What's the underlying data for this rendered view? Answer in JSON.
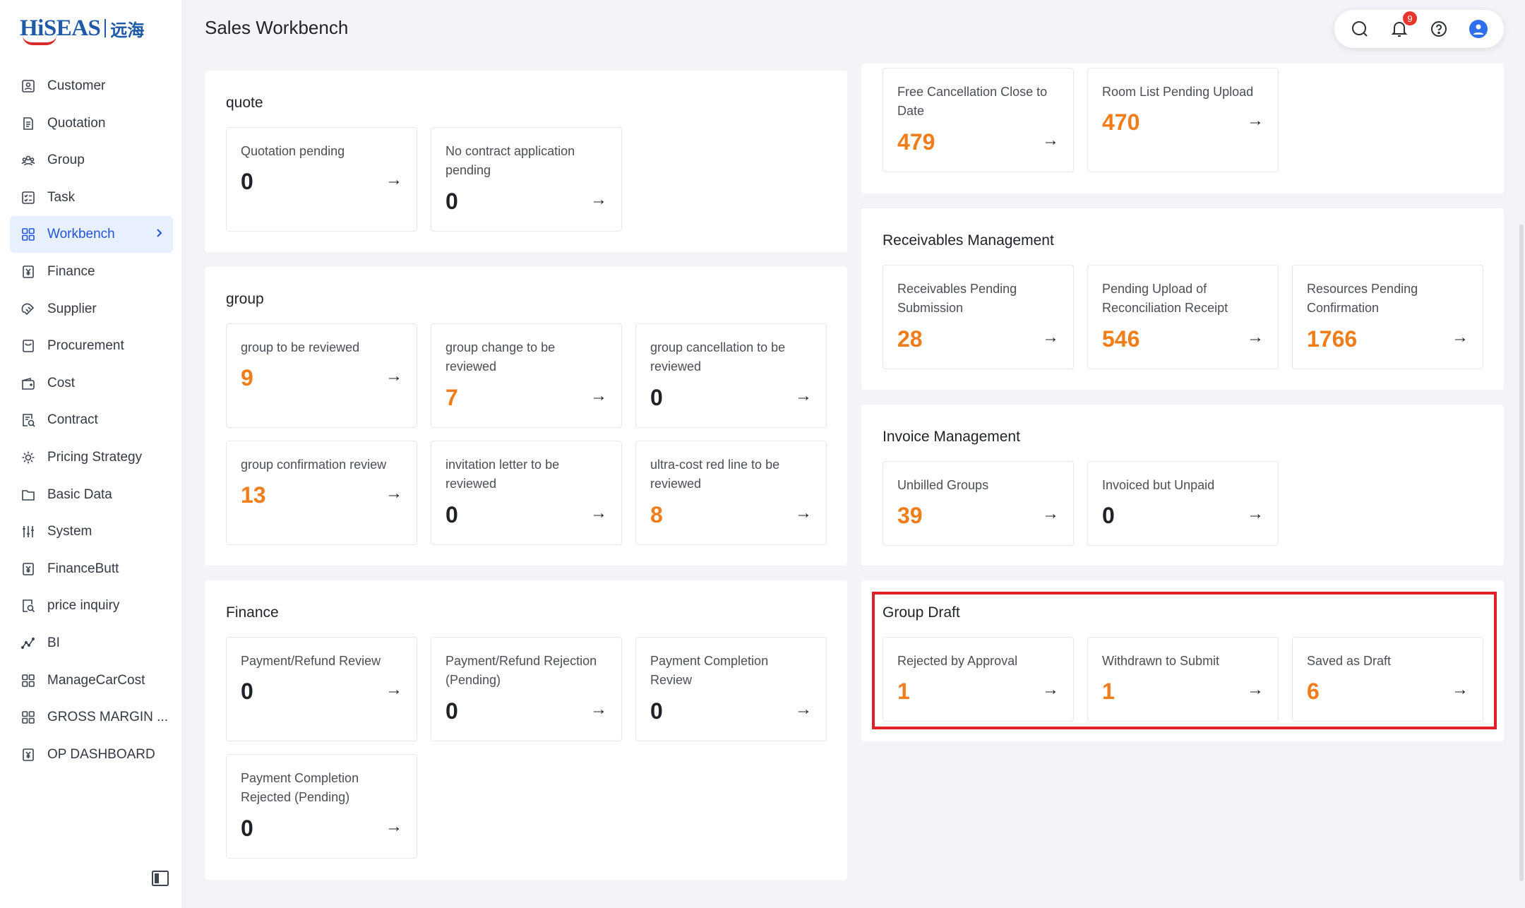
{
  "app": {
    "logo_text": "HiSEAS",
    "logo_cn": "远海",
    "page_title": "Sales Workbench"
  },
  "header": {
    "notification_count": "9",
    "icons": [
      "search-icon",
      "bell-icon",
      "help-icon",
      "user-icon"
    ]
  },
  "sidebar": {
    "items": [
      {
        "label": "Customer",
        "icon": "customer-icon"
      },
      {
        "label": "Quotation",
        "icon": "quotation-icon"
      },
      {
        "label": "Group",
        "icon": "group-icon"
      },
      {
        "label": "Task",
        "icon": "task-icon"
      },
      {
        "label": "Workbench",
        "icon": "workbench-icon",
        "active": true
      },
      {
        "label": "Finance",
        "icon": "finance-icon"
      },
      {
        "label": "Supplier",
        "icon": "supplier-icon"
      },
      {
        "label": "Procurement",
        "icon": "procurement-icon"
      },
      {
        "label": "Cost",
        "icon": "cost-icon"
      },
      {
        "label": "Contract",
        "icon": "contract-icon"
      },
      {
        "label": "Pricing  Strategy",
        "icon": "pricing-icon"
      },
      {
        "label": "Basic  Data",
        "icon": "basic-data-icon"
      },
      {
        "label": "System",
        "icon": "system-icon"
      },
      {
        "label": "FinanceButt",
        "icon": "finance-butt-icon"
      },
      {
        "label": "price  inquiry",
        "icon": "price-inquiry-icon"
      },
      {
        "label": "BI",
        "icon": "bi-icon"
      },
      {
        "label": "ManageCarCost",
        "icon": "manage-car-cost-icon"
      },
      {
        "label": "GROSS  MARGIN  ...",
        "icon": "gross-margin-icon"
      },
      {
        "label": "OP  DASHBOARD",
        "icon": "op-dashboard-icon"
      }
    ]
  },
  "sections": {
    "quote": {
      "title": "quote",
      "cards": [
        {
          "label": "Quotation pending",
          "value": "0"
        },
        {
          "label": "No contract application pending",
          "value": "0"
        }
      ]
    },
    "group": {
      "title": "group",
      "cards": [
        {
          "label": "group to be reviewed",
          "value": "9"
        },
        {
          "label": "group change to be reviewed",
          "value": "7"
        },
        {
          "label": "group cancellation to be reviewed",
          "value": "0"
        },
        {
          "label": "group confirmation review",
          "value": "13"
        },
        {
          "label": "invitation letter to be reviewed",
          "value": "0"
        },
        {
          "label": "ultra-cost red line to be reviewed",
          "value": "8"
        }
      ]
    },
    "finance": {
      "title": "Finance",
      "cards": [
        {
          "label": "Payment/Refund Review",
          "value": "0"
        },
        {
          "label": "Payment/Refund Rejection (Pending)",
          "value": "0"
        },
        {
          "label": "Payment Completion Review",
          "value": "0"
        },
        {
          "label": "Payment Completion Rejected (Pending)",
          "value": "0"
        }
      ]
    },
    "rooms": {
      "cards": [
        {
          "label": "Free Cancellation Close to Date",
          "value": "479"
        },
        {
          "label": "Room List Pending Upload",
          "value": "470"
        }
      ]
    },
    "receivables": {
      "title": "Receivables Management",
      "cards": [
        {
          "label": "Receivables Pending Submission",
          "value": "28"
        },
        {
          "label": "Pending Upload of Reconciliation Receipt",
          "value": "546"
        },
        {
          "label": "Resources Pending Confirmation",
          "value": "1766"
        }
      ]
    },
    "invoice": {
      "title": "Invoice Management",
      "cards": [
        {
          "label": "Unbilled Groups",
          "value": "39"
        },
        {
          "label": "Invoiced but Unpaid",
          "value": "0"
        }
      ]
    },
    "draft": {
      "title": "Group Draft",
      "cards": [
        {
          "label": "Rejected by Approval",
          "value": "1"
        },
        {
          "label": "Withdrawn to Submit",
          "value": "1"
        },
        {
          "label": "Saved as Draft",
          "value": "6"
        }
      ]
    }
  },
  "arrow_glyph": "→",
  "colors": {
    "accent": "#2156d9",
    "value_orange": "#f07d1a",
    "highlight_red": "#e01f26",
    "badge_red": "#e8362f"
  }
}
